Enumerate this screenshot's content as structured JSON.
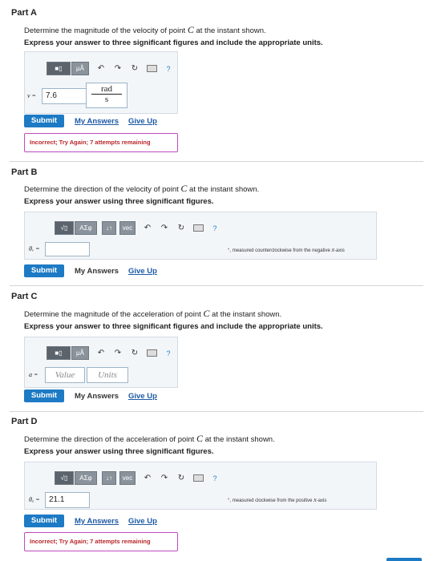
{
  "toolbar": {
    "matrix_label": "■▯",
    "micro_label": "μÅ",
    "sqrt_label": "√▯",
    "greek_label": "ΑΣφ",
    "arrows_label": "↓↑",
    "vec_label": "vec",
    "undo_icon": "↶",
    "redo_icon": "↷",
    "reset_icon": "↻",
    "help_label": "?"
  },
  "common": {
    "submit_label": "Submit",
    "my_answers_label": "My Answers",
    "give_up_label": "Give Up"
  },
  "partA": {
    "title": "Part A",
    "prompt_pre": "Determine the magnitude of the velocity of point ",
    "point": "C",
    "prompt_post": " at the instant shown.",
    "express": "Express your answer to three significant figures and include the appropriate units.",
    "var": "v =",
    "value": "7.6",
    "unit_num": "rad",
    "unit_den": "s",
    "feedback": "Incorrect; Try Again; 7 attempts remaining"
  },
  "partB": {
    "title": "Part B",
    "prompt_pre": "Determine the direction of the velocity of point ",
    "point": "C",
    "prompt_post": " at the instant shown.",
    "express": "Express your answer using three significant figures.",
    "var": "θᵥ =",
    "value": "",
    "note_pre": "°, measured counterclockwise from the negative ",
    "note_axis": "x",
    "note_post": "-axis"
  },
  "partC": {
    "title": "Part C",
    "prompt_pre": "Determine the magnitude of the acceleration of point ",
    "point": "C",
    "prompt_post": " at the instant shown.",
    "express": "Express your answer to three significant figures and include the appropriate units.",
    "var": "a =",
    "value_placeholder": "Value",
    "units_placeholder": "Units"
  },
  "partD": {
    "title": "Part D",
    "prompt_pre": "Determine the direction of the acceleration of point ",
    "point": "C",
    "prompt_post": " at the instant shown.",
    "express": "Express your answer using three significant figures.",
    "var": "θₐ =",
    "value": "21.1",
    "note_pre": "°, measured clockwise from the positive ",
    "note_axis": "x",
    "note_post": "-axis",
    "feedback": "Incorrect; Try Again; 7 attempts remaining"
  }
}
